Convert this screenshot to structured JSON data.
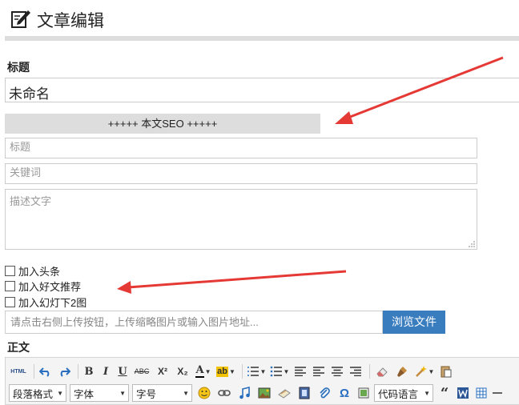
{
  "header": {
    "title": "文章编辑"
  },
  "form": {
    "title_label": "标题",
    "title_value": "未命名",
    "seo_header": "+++++ 本文SEO +++++",
    "seo_title_placeholder": "标题",
    "seo_keywords_placeholder": "关键词",
    "seo_description_placeholder": "描述文字",
    "checkboxes": [
      {
        "label": "加入头条",
        "checked": false
      },
      {
        "label": "加入好文推荐",
        "checked": false
      },
      {
        "label": "加入幻灯下2图",
        "checked": false
      }
    ],
    "thumbnail_placeholder": "请点击右侧上传按钮，上传缩略图片或输入图片地址...",
    "browse_button": "浏览文件",
    "body_label": "正文"
  },
  "editor": {
    "row1": [
      "html-icon",
      "undo-icon",
      "redo-icon",
      "bold-icon",
      "italic-icon",
      "underline-icon",
      "strikethrough-icon",
      "superscript-icon",
      "subscript-icon",
      "font-color-icon",
      "highlight-icon",
      "ordered-list-icon",
      "unordered-list-icon",
      "align-justify-icon",
      "align-left-icon",
      "align-center-icon",
      "align-right-icon",
      "eraser-icon",
      "format-brush-icon",
      "magic-wand-icon",
      "paste-icon"
    ],
    "html_label": "HTML",
    "bold_label": "B",
    "italic_label": "I",
    "underline_label": "U",
    "strike_label": "ABC",
    "superscript_label": "X²",
    "subscript_label": "X₂",
    "font_color_label": "A",
    "highlight_label": "ab",
    "paragraph_format": "段落格式",
    "font_family": "字体",
    "font_size": "字号",
    "code_language": "代码语言"
  },
  "colors": {
    "accent": "#3a7dbf",
    "arrow": "#e53935",
    "bar": "#dddddd"
  }
}
